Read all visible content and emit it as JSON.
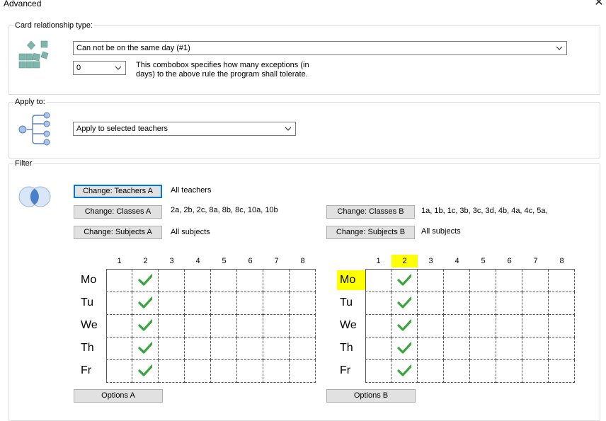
{
  "window": {
    "title": "Advanced"
  },
  "card_relationship": {
    "legend": "Card relationship type:",
    "type_value": "Can not be on the same day (#1)",
    "exceptions_value": "0",
    "exceptions_desc": "This combobox specifies how many exceptions (in days) to the above rule the program shall tolerate."
  },
  "apply_to": {
    "legend": "Apply to:",
    "value": "Apply to selected teachers"
  },
  "filter": {
    "legend": "Filter",
    "change_teachers_a": "Change: Teachers A",
    "teachers_a_value": "All teachers",
    "change_classes_a": "Change: Classes A",
    "classes_a_value": "2a, 2b, 2c, 8a, 8b, 8c, 10a, 10b",
    "change_subjects_a": "Change: Subjects A",
    "subjects_a_value": "All subjects",
    "change_classes_b": "Change: Classes B",
    "classes_b_value": "1a, 1b, 1c, 3b, 3c, 3d, 4b, 4a, 4c, 5a,",
    "change_subjects_b": "Change: Subjects B",
    "subjects_b_value": "All subjects",
    "options_a": "Options A",
    "options_b": "Options B"
  },
  "grid_a": {
    "periods": [
      "1",
      "2",
      "3",
      "4",
      "5",
      "6",
      "7",
      "8"
    ],
    "days": [
      "Mo",
      "Tu",
      "We",
      "Th",
      "Fr"
    ],
    "checked_period": "2",
    "highlight_period": "",
    "highlight_day": ""
  },
  "grid_b": {
    "periods": [
      "1",
      "2",
      "3",
      "4",
      "5",
      "6",
      "7",
      "8"
    ],
    "days": [
      "Mo",
      "Tu",
      "We",
      "Th",
      "Fr"
    ],
    "checked_period": "2",
    "highlight_period": "2",
    "highlight_day": "Mo"
  },
  "colors": {
    "check": "#3aa53a",
    "highlight": "#ffff00",
    "icon": "#7fb5ad",
    "focus": "#0078d7"
  }
}
